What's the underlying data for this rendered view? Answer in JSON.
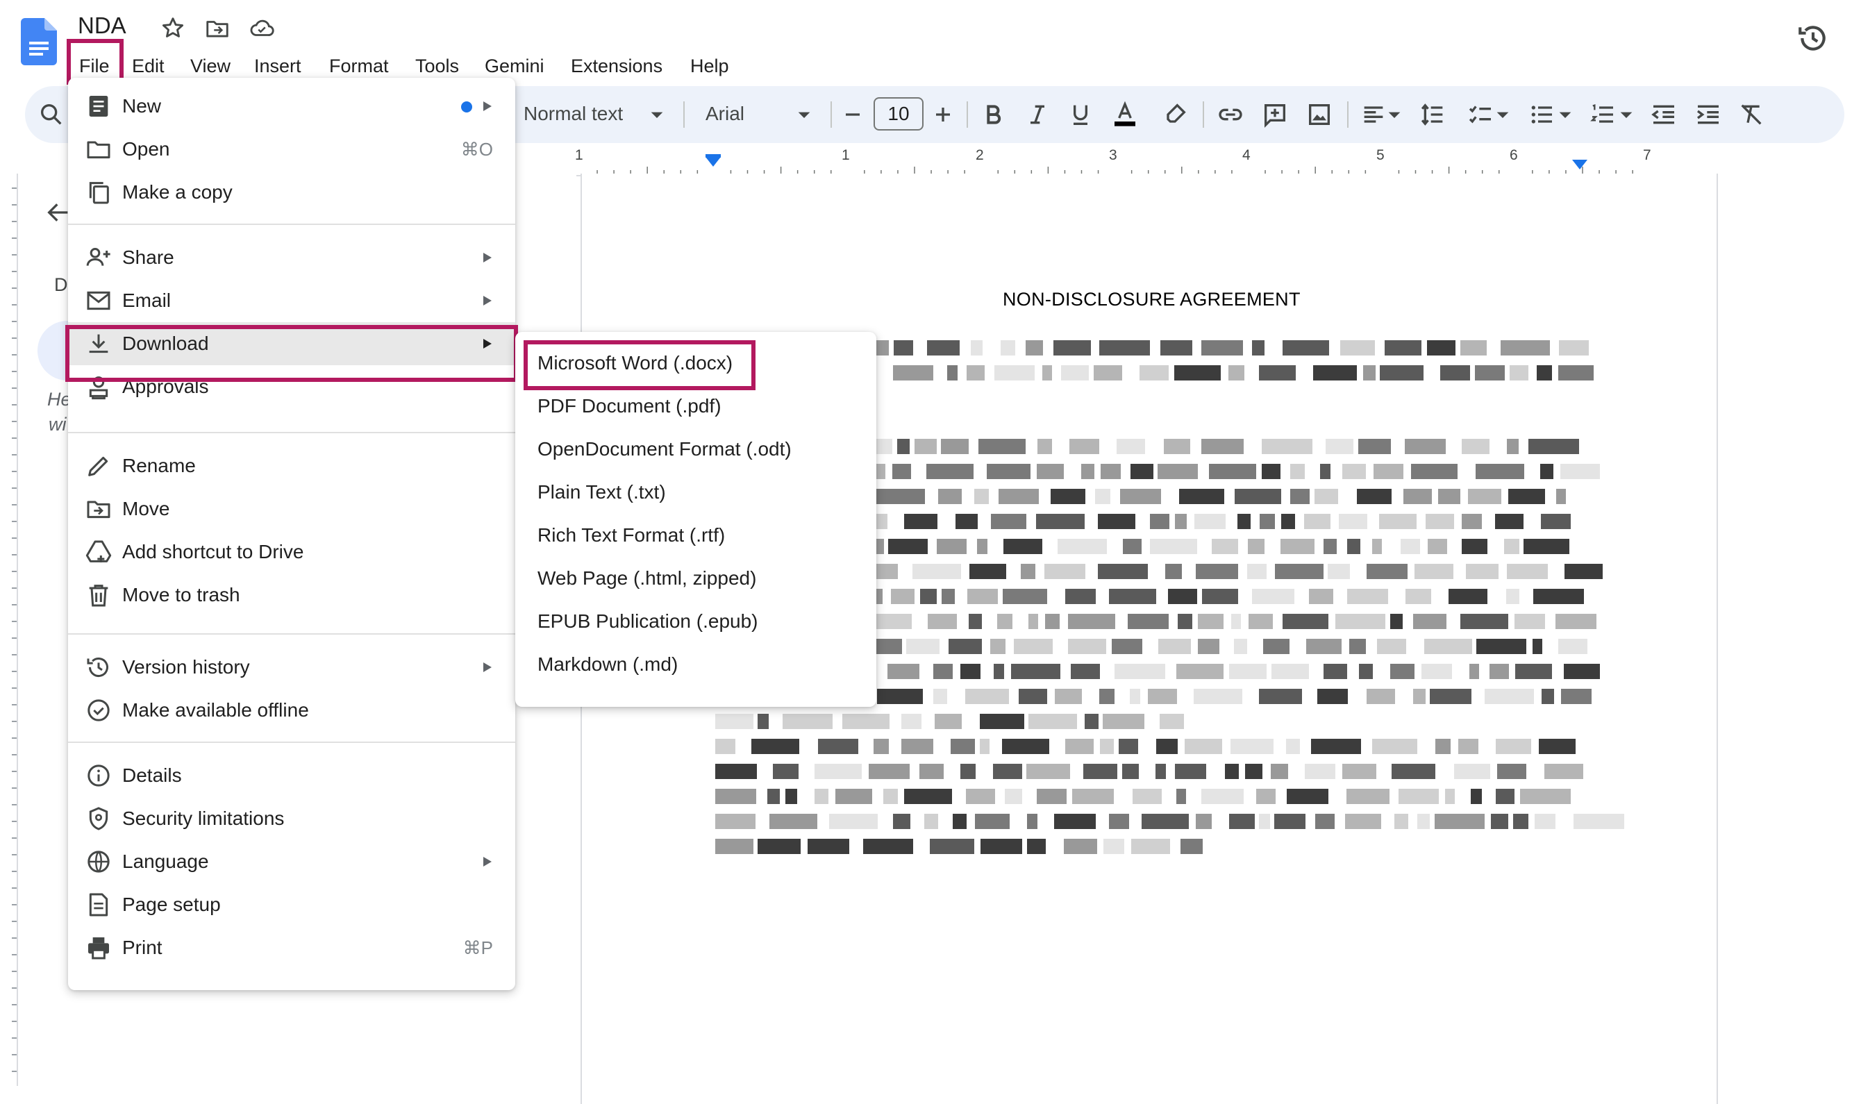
{
  "document": {
    "title": "NDA",
    "heading": "NON-DISCLOSURE AGREEMENT"
  },
  "menubar": [
    "File",
    "Edit",
    "View",
    "Insert",
    "Format",
    "Tools",
    "Gemini",
    "Extensions",
    "Help"
  ],
  "toolbar": {
    "style": "Normal text",
    "font": "Arial",
    "font_size": "10"
  },
  "ruler": [
    "1",
    "1",
    "2",
    "3",
    "4",
    "5",
    "6",
    "7"
  ],
  "outline": {
    "letter": "D",
    "line1": "He",
    "line2": "wi"
  },
  "file_menu": {
    "new": "New",
    "open": "Open",
    "open_shortcut": "⌘O",
    "copy": "Make a copy",
    "share": "Share",
    "email": "Email",
    "download": "Download",
    "approvals": "Approvals",
    "rename": "Rename",
    "move": "Move",
    "shortcut": "Add shortcut to Drive",
    "trash": "Move to trash",
    "version": "Version history",
    "offline": "Make available offline",
    "details": "Details",
    "security": "Security limitations",
    "language": "Language",
    "page_setup": "Page setup",
    "print": "Print",
    "print_shortcut": "⌘P"
  },
  "download_menu": [
    "Microsoft Word (.docx)",
    "PDF Document (.pdf)",
    "OpenDocument Format (.odt)",
    "Plain Text (.txt)",
    "Rich Text Format (.rtf)",
    "Web Page (.html, zipped)",
    "EPUB Publication (.epub)",
    "Markdown (.md)"
  ],
  "colors": {
    "highlight": "#b3195f",
    "accent": "#1a73e8",
    "toolbar_bg": "#edf2fa"
  }
}
